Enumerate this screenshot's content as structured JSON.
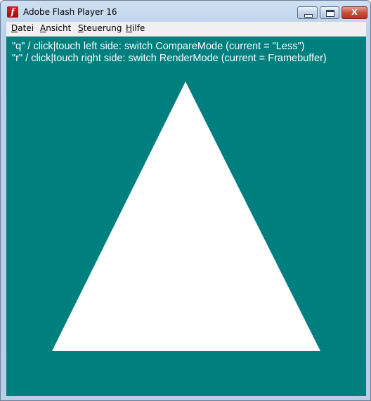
{
  "window": {
    "title": "Adobe Flash Player 16",
    "app_icon": "flash-icon",
    "controls": {
      "minimize": "minimize-icon",
      "maximize": "maximize-icon",
      "close": "close-icon"
    },
    "close_glyph": "x"
  },
  "menubar": {
    "items": [
      {
        "accel": "D",
        "rest": "atei"
      },
      {
        "accel": "A",
        "rest": "nsicht"
      },
      {
        "accel": "S",
        "rest": "teuerung"
      },
      {
        "accel": "H",
        "rest": "ilfe"
      }
    ]
  },
  "stage": {
    "background": "#007f7f",
    "shape_color": "#ffffff",
    "lines": [
      "\"q\" / click|touch left side: switch CompareMode (current = \"Less\")",
      "\"r\" / click|touch right side: switch RenderMode (current = Framebuffer)"
    ]
  },
  "colors": {
    "stage_bg": "#007f7f",
    "shape": "#ffffff",
    "close_button": "#c9503a"
  }
}
